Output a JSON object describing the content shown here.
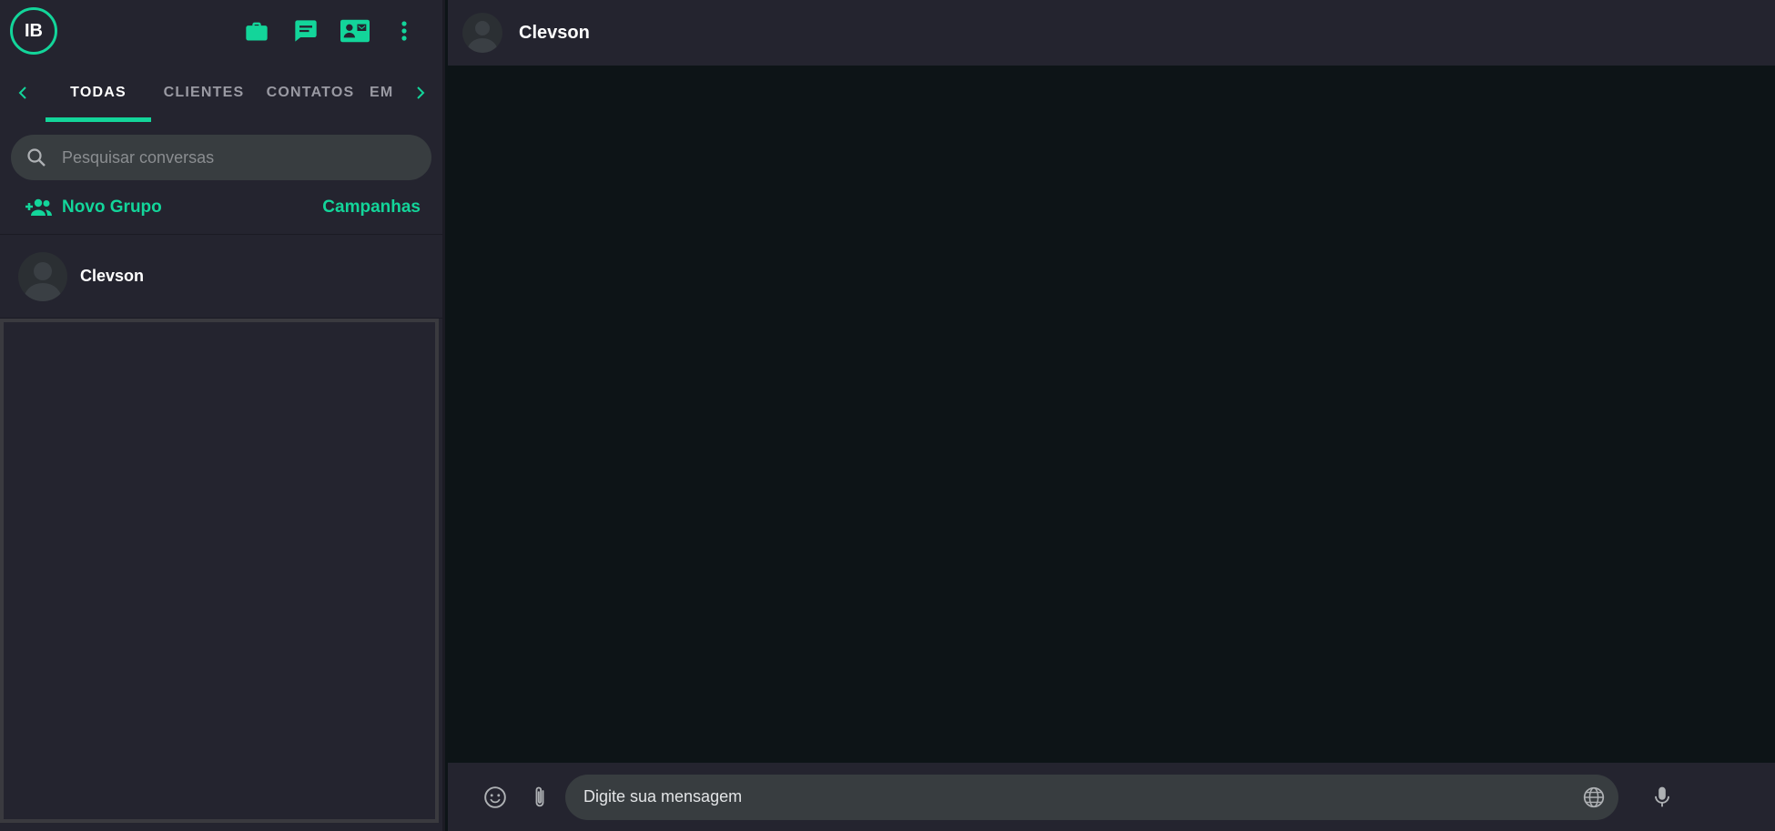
{
  "profile": {
    "initials": "IB"
  },
  "tabs": [
    {
      "label": "TODAS"
    },
    {
      "label": "CLIENTES"
    },
    {
      "label": "CONTATOS"
    },
    {
      "label": "EM"
    }
  ],
  "search": {
    "placeholder": "Pesquisar conversas",
    "value": ""
  },
  "actions": {
    "new_group": "Novo Grupo",
    "campaigns": "Campanhas"
  },
  "chats": [
    {
      "name": "Clevson"
    }
  ],
  "chat_header": {
    "name": "Clevson"
  },
  "composer": {
    "placeholder": "Digite sua mensagem",
    "value": ""
  },
  "colors": {
    "accent": "#13d59a",
    "panel": "#24242f",
    "background": "#0d1417",
    "input": "#383d40"
  },
  "icons": [
    "briefcase-icon",
    "chat-icon",
    "contact-card-icon",
    "more-vert-icon",
    "chevron-left-icon",
    "chevron-right-icon",
    "search-icon",
    "group-add-icon",
    "emoji-icon",
    "attach-icon",
    "globe-icon",
    "mic-icon"
  ]
}
